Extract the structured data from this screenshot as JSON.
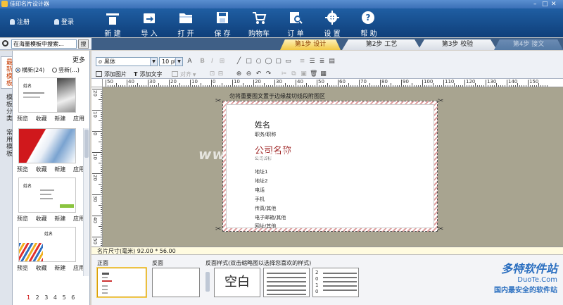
{
  "window": {
    "title": "佳印名片设计器"
  },
  "account": {
    "register": "注册",
    "login": "登录"
  },
  "toolbar": {
    "buttons": [
      {
        "id": "new",
        "label": "新 建",
        "icon": "new-document-icon"
      },
      {
        "id": "import",
        "label": "导 入",
        "icon": "import-icon"
      },
      {
        "id": "open",
        "label": "打 开",
        "icon": "folder-icon"
      },
      {
        "id": "save",
        "label": "保 存",
        "icon": "floppy-disk-icon"
      },
      {
        "id": "cart",
        "label": "购物车",
        "icon": "shopping-cart-icon"
      },
      {
        "id": "order",
        "label": "订 单",
        "icon": "order-search-icon"
      },
      {
        "id": "settings",
        "label": "设 置",
        "icon": "gear-icon"
      },
      {
        "id": "help",
        "label": "帮 助",
        "icon": "help-icon"
      }
    ]
  },
  "search": {
    "placeholder": "在海量模板中搜索...",
    "button": "搜"
  },
  "steps": [
    {
      "label": "第1步  设计",
      "state": "active"
    },
    {
      "label": "第2步  工艺",
      "state": "normal"
    },
    {
      "label": "第3步  校验",
      "state": "normal"
    },
    {
      "label": "第4步  接文",
      "state": "disabled"
    }
  ],
  "sidebar": {
    "tabs": [
      "最新模板",
      "模板分类",
      "常用模板"
    ],
    "more": "更多",
    "orientation": {
      "horizontal": "横新(24)",
      "vertical": "竖新(...)"
    },
    "template_actions": [
      "预览",
      "收藏",
      "新建",
      "应用"
    ],
    "templates": [
      {
        "thumb_label": "姓名"
      },
      {
        "thumb_label": ""
      },
      {
        "thumb_label": "姓名"
      },
      {
        "thumb_label": "姓名"
      }
    ],
    "pages": [
      "1",
      "2",
      "3",
      "4",
      "5",
      "6"
    ]
  },
  "format_toolbar": {
    "font": "黑体",
    "size": "10 pt",
    "add_image": "添加图片",
    "add_text": "添加文字",
    "align": "对齐"
  },
  "ruler": {
    "h_labels": [
      "50",
      "40",
      "30",
      "20",
      "10",
      "0",
      "10",
      "20",
      "30",
      "40",
      "50",
      "60",
      "70",
      "80",
      "90",
      "100",
      "110",
      "120",
      "130",
      "140",
      "150"
    ],
    "v_labels": [
      "20",
      "10",
      "0",
      "10",
      "20",
      "30",
      "40",
      "50"
    ]
  },
  "canvas": {
    "bleed_note": "勿将重要图文置于边缘裁切线段附图区",
    "card": {
      "name": "姓名",
      "title": "职务/职称",
      "company": "公司名称",
      "company_sub": "公司名称",
      "lines": [
        "地址1",
        "地址2",
        "电话",
        "手机",
        "传真/其他",
        "电子邮箱/其他",
        "网址/其他"
      ]
    },
    "watermark": "www.DuoTe.com"
  },
  "sizebar": {
    "text": "名片尺寸(毫米) 92.00 * 56.00"
  },
  "styles": {
    "front": "正面",
    "back": "反面",
    "bg_hint": "反面样式(双击缩略图以选择您喜欢的样式)",
    "blank": "空白",
    "calendar_year": "2010"
  },
  "brand": {
    "name": "多特软件站",
    "url": "DuoTe.Com",
    "slogan": "国内最安全的软件站"
  },
  "colors": {
    "toolbar": "#1f5ea3",
    "active_step": "#f2c844",
    "company_text": "#9c1f1f"
  }
}
